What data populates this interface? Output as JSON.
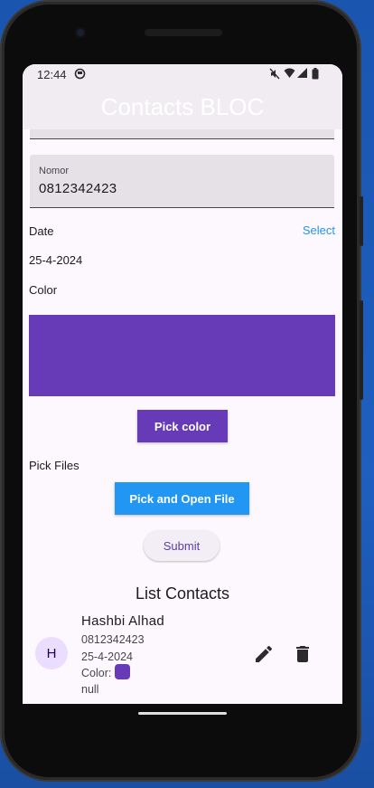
{
  "status_bar": {
    "time": "12:44"
  },
  "app_bar": {
    "title": "Contacts BLOC"
  },
  "form": {
    "nomor_label": "Nomor",
    "nomor_value": "0812342423",
    "date_label": "Date",
    "select_label": "Select",
    "date_value": "25-4-2024",
    "color_label": "Color",
    "selected_color": "#673ab7",
    "pick_color_label": "Pick color",
    "pick_files_label": "Pick Files",
    "pick_open_file_label": "Pick and Open File",
    "submit_label": "Submit"
  },
  "list": {
    "title": "List Contacts",
    "contacts": [
      {
        "initial": "H",
        "name": "Hashbi Alhad",
        "nomor": "0812342423",
        "date": "25-4-2024",
        "color_label": "Color:",
        "color": "#673ab7",
        "file": "null"
      }
    ]
  },
  "colors": {
    "accent": "#673ab7",
    "pick_file_button": "#2196f3",
    "link": "#2196f3"
  },
  "icons": [
    "mute-icon",
    "wifi-icon",
    "signal-icon",
    "battery-icon",
    "edit-icon",
    "delete-icon"
  ]
}
